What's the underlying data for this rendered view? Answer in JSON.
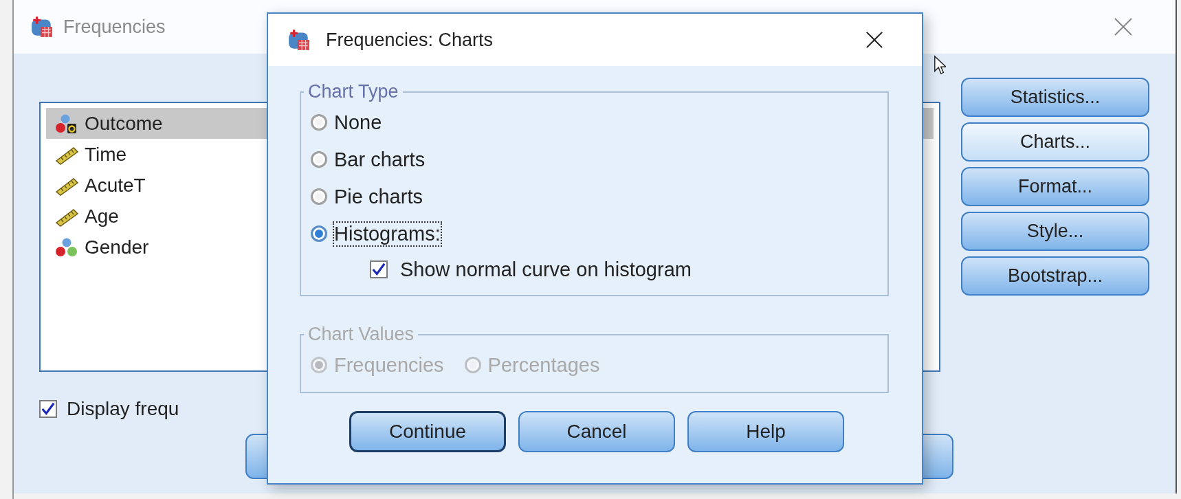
{
  "main_window": {
    "title": "Frequencies",
    "variables": [
      {
        "name": "Outcome",
        "kind": "string",
        "selected": true
      },
      {
        "name": "Time",
        "kind": "scale",
        "selected": false
      },
      {
        "name": "AcuteT",
        "kind": "scale",
        "selected": false
      },
      {
        "name": "Age",
        "kind": "scale",
        "selected": false
      },
      {
        "name": "Gender",
        "kind": "nominal",
        "selected": false
      }
    ],
    "side_buttons": [
      {
        "label": "Statistics...",
        "highlighted": false
      },
      {
        "label": "Charts...",
        "highlighted": true
      },
      {
        "label": "Format...",
        "highlighted": false
      },
      {
        "label": "Style...",
        "highlighted": false
      },
      {
        "label": "Bootstrap...",
        "highlighted": false
      }
    ],
    "display_checkbox": {
      "label": "Display frequ",
      "checked": true
    }
  },
  "dialog": {
    "title": "Frequencies: Charts",
    "chart_type": {
      "legend": "Chart Type",
      "options": [
        {
          "label": "None",
          "selected": false
        },
        {
          "label": "Bar charts",
          "selected": false
        },
        {
          "label": "Pie charts",
          "selected": false
        },
        {
          "label": "Histograms:",
          "selected": true
        }
      ],
      "normal_curve": {
        "label": "Show normal curve on histogram",
        "checked": true
      }
    },
    "chart_values": {
      "legend": "Chart Values",
      "disabled": true,
      "options": [
        {
          "label": "Frequencies",
          "selected": true
        },
        {
          "label": "Percentages",
          "selected": false
        }
      ]
    },
    "buttons": [
      {
        "label": "Continue",
        "default": true
      },
      {
        "label": "Cancel",
        "default": false
      },
      {
        "label": "Help",
        "default": false
      }
    ]
  }
}
